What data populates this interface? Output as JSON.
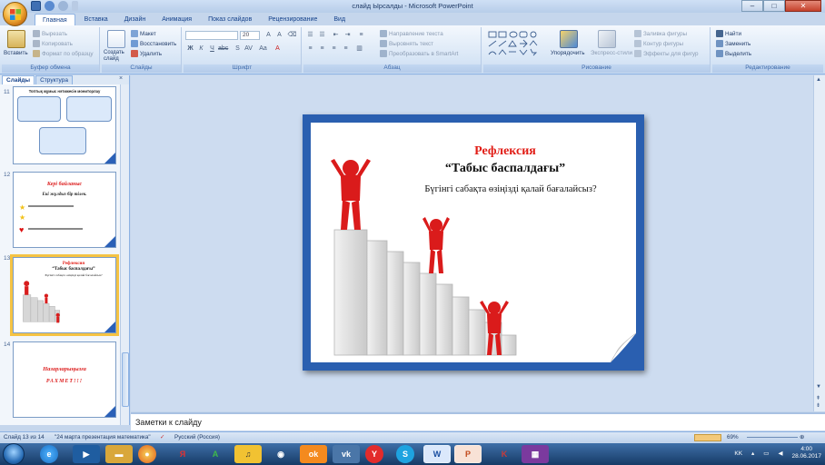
{
  "window": {
    "title": "слайд Ырсалды - Microsoft PowerPoint",
    "min_label": "–",
    "max_label": "□",
    "close_label": "✕"
  },
  "tabs": [
    "Главная",
    "Вставка",
    "Дизайн",
    "Анимация",
    "Показ слайдов",
    "Рецензирование",
    "Вид"
  ],
  "ribbon": {
    "clipboard": {
      "label": "Буфер обмена",
      "paste": "Вставить",
      "cut": "Вырезать",
      "copy": "Копировать",
      "format_painter": "Формат по образцу"
    },
    "slides": {
      "label": "Слайды",
      "new_slide": "Создать слайд",
      "layout": "Макет",
      "reset": "Восстановить",
      "delete": "Удалить"
    },
    "font": {
      "label": "Шрифт",
      "size": "20"
    },
    "paragraph": {
      "label": "Абзац",
      "text_direction": "Направление текста",
      "align_text": "Выровнять текст",
      "smartart": "Преобразовать в SmartArt"
    },
    "drawing": {
      "label": "Рисование",
      "arrange": "Упорядочить",
      "quick_styles": "Экспресс-стили",
      "shape_fill": "Заливка фигуры",
      "shape_outline": "Контур фигуры",
      "shape_effects": "Эффекты для фигур"
    },
    "editing": {
      "label": "Редактирование",
      "find": "Найти",
      "replace": "Заменить",
      "select": "Выделить"
    }
  },
  "panel": {
    "tab_slides": "Слайды",
    "tab_outline": "Структура",
    "close": "×"
  },
  "thumbnails": [
    {
      "num": "11",
      "title": "Топтық жұмыс нәтижесін мониторлау"
    },
    {
      "num": "12",
      "title": "Кері байланыс",
      "subtitle": "Екі жұлдыз бір тілек."
    },
    {
      "num": "13",
      "title": "Рефлексия",
      "subtitle": "“Табыс баспалдағы”",
      "text": "Бүгінгі сабақта өзіңізді қалай бағалайсыз?"
    },
    {
      "num": "14",
      "title": "Назарларыңызға",
      "subtitle": "РАХМЕТ!!!"
    }
  ],
  "slide": {
    "title": "Рефлексия",
    "subtitle": "“Табыс баспалдағы”",
    "question": "Бүгінгі сабақта өзіңізді қалай бағалайсыз?"
  },
  "notes_placeholder": "Заметки к слайду",
  "status": {
    "slide_counter": "Слайд 13 из 14",
    "theme": "\"24 марта презентация математика\"",
    "language": "Русский (Россия)",
    "zoom": "69%"
  },
  "taskbar": {
    "lang": "KK",
    "time": "4:00",
    "date": "28.06.2017"
  },
  "colors": {
    "accent_red": "#e11d16",
    "slide_border": "#2a5fb0",
    "ribbon_bg": "#d8e6f6"
  }
}
